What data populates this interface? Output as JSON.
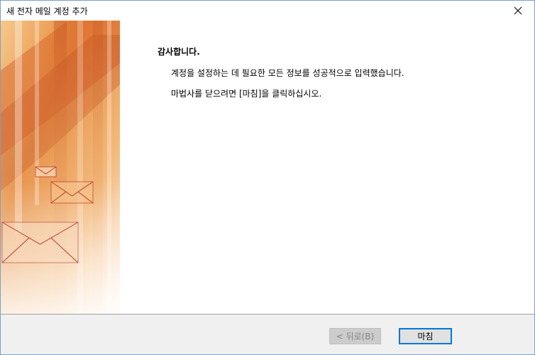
{
  "window": {
    "title": "새 전자 메일 계정 추가",
    "close_icon": "close-icon"
  },
  "page": {
    "heading": "감사합니다.",
    "message1": "계정을 설정하는 데 필요한 모든 정보를 성공적으로 입력했습니다.",
    "message2": "마법사를 닫으려면 [마침]을 클릭하십시오."
  },
  "banner": {
    "image": "envelope-wizard-banner",
    "colors": [
      "#e07a28",
      "#f3b66a",
      "#c04a1c",
      "#fae2c0"
    ]
  },
  "buttons": {
    "back_label": "< 뒤로(B)",
    "back_enabled": false,
    "finish_label": "마침"
  },
  "colors": {
    "accent": "#0078d7",
    "window_border": "#7a9fc9"
  }
}
